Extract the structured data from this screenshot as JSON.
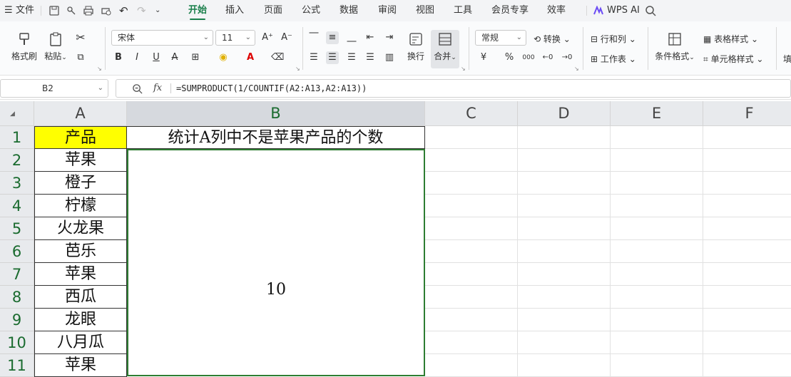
{
  "menubar": {
    "menu_label": "文件",
    "tabs": [
      "开始",
      "插入",
      "页面",
      "公式",
      "数据",
      "审阅",
      "视图",
      "工具",
      "会员专享",
      "效率"
    ],
    "active_tab": "开始",
    "wps_ai": "WPS AI"
  },
  "ribbon": {
    "format_painter": "格式刷",
    "paste": "粘贴",
    "font_name": "宋体",
    "font_size": "11",
    "bold": "B",
    "italic": "I",
    "underline": "U",
    "wrap": "换行",
    "merge": "合并",
    "number_format": "常规",
    "convert": "转换",
    "row_col": "行和列",
    "worksheet": "工作表",
    "cond_format": "条件格式",
    "table_style": "表格样式",
    "cell_style": "单元格样式",
    "fill": "填",
    "percent": "%",
    "thousands": "000",
    "currency": "¥"
  },
  "formula_bar": {
    "cell_ref": "B2",
    "fx": "fx",
    "formula": "=SUMPRODUCT(1/COUNTIF(A2:A13,A2:A13))"
  },
  "columns": [
    "A",
    "B",
    "C",
    "D",
    "E",
    "F"
  ],
  "rows": [
    "1",
    "2",
    "3",
    "4",
    "5",
    "6",
    "7",
    "8",
    "9",
    "10",
    "11"
  ],
  "cells": {
    "A1": "产品",
    "B1": "统计A列中不是苹果产品的个数",
    "A": [
      "苹果",
      "橙子",
      "柠檬",
      "火龙果",
      "芭乐",
      "苹果",
      "西瓜",
      "龙眼",
      "八月瓜",
      "苹果"
    ],
    "B2_value": "10"
  },
  "colors": {
    "accent": "#1a7f4b",
    "header_fill": "#ffff00",
    "selection": "#2e7d32"
  }
}
